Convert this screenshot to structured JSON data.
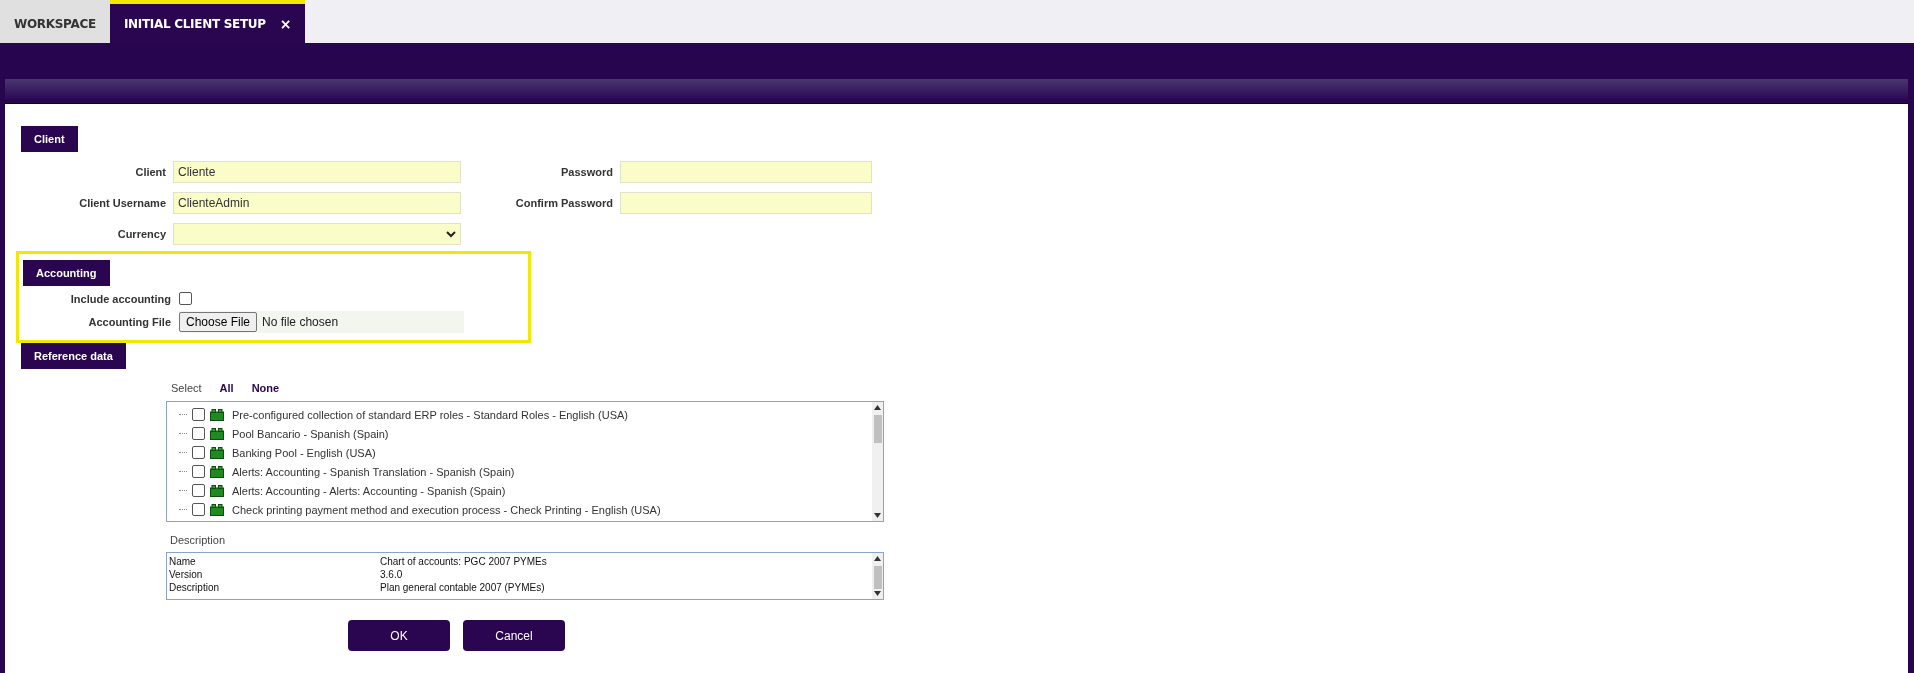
{
  "tabs": [
    {
      "label": "WORKSPACE",
      "selected": false
    },
    {
      "label": "INITIAL CLIENT SETUP",
      "selected": true,
      "close_glyph": "×"
    }
  ],
  "client_section": {
    "title": "Client",
    "fields": [
      {
        "label": "Client",
        "value": "Cliente",
        "kind": "text"
      },
      {
        "label": "Password",
        "kind": "text"
      },
      {
        "label": "Client Username",
        "value": "ClienteAdmin",
        "kind": "text"
      },
      {
        "label": "Confirm Password",
        "kind": "text"
      },
      {
        "label": "Currency",
        "kind": "select"
      }
    ]
  },
  "accounting_section": {
    "title": "Accounting",
    "highlighted": true,
    "include_label": "Include accounting",
    "include_checked": false,
    "file_label": "Accounting File",
    "file_button": "Choose File",
    "file_status": "No file chosen"
  },
  "reference_section": {
    "title": "Reference data",
    "select_label": "Select",
    "select_all": "All",
    "select_none": "None",
    "items": [
      {
        "label": "Pre-configured collection of standard ERP roles - Standard Roles - English (USA)",
        "checked": false
      },
      {
        "label": "Pool Bancario - Spanish (Spain)",
        "checked": false
      },
      {
        "label": "Banking Pool - English (USA)",
        "checked": false
      },
      {
        "label": "Alerts: Accounting - Spanish Translation - Spanish (Spain)",
        "checked": false
      },
      {
        "label": "Alerts: Accounting - Alerts: Accounting - Spanish (Spain)",
        "checked": false
      },
      {
        "label": "Check printing payment method and execution process - Check Printing - English (USA)",
        "checked": false
      }
    ],
    "description_label": "Description",
    "description_rows": [
      {
        "key": "Name",
        "value": "Chart of accounts: PGC 2007 PYMEs"
      },
      {
        "key": "Version",
        "value": "3.6.0"
      },
      {
        "key": "Description",
        "value": "Plan general contable 2007 (PYMEs)"
      }
    ]
  },
  "buttons": [
    "OK",
    "Cancel"
  ]
}
